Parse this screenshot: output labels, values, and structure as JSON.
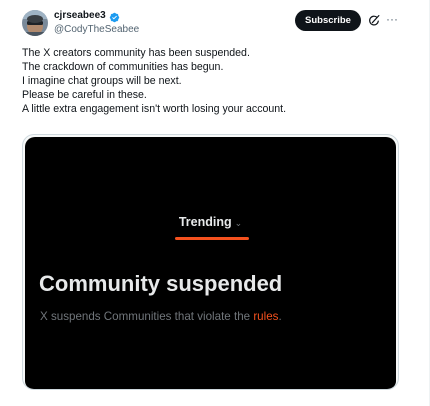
{
  "author": {
    "display_name": "cjrseabee3",
    "handle": "@CodyTheSeabee",
    "verified": true
  },
  "actions": {
    "subscribe_label": "Subscribe",
    "grok_icon": "grok-icon",
    "more_icon": "more-icon"
  },
  "tweet": {
    "lines": [
      "The X creators community has been suspended.",
      "The crackdown of communities has begun.",
      "I imagine chat groups will be next.",
      "Please be careful in these.",
      "A little extra engagement isn't worth losing your account."
    ]
  },
  "media": {
    "tab_label": "Trending",
    "tab_chevron": "⌄",
    "title": "Community suspended",
    "description_prefix": "X suspends Communities that violate the ",
    "description_link": "rules",
    "description_suffix": "."
  },
  "colors": {
    "accent_orange": "#f4511e",
    "verified_blue": "#1d9bf0",
    "subscribe_bg": "#0f1419"
  }
}
